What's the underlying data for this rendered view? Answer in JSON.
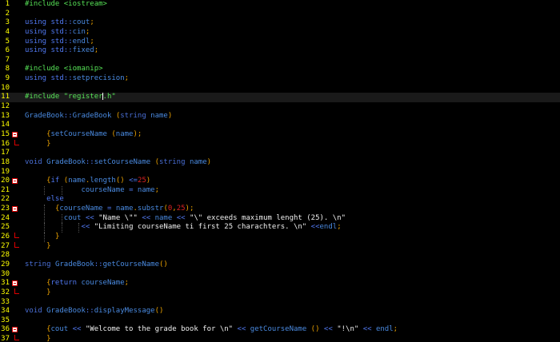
{
  "editor": {
    "colors": {
      "background": "#000000",
      "line_number": "#ffff00",
      "preprocessor": "#56e156",
      "keyword": "#5078f0",
      "punctuation": "#e8a000",
      "string": "#f0f0f0",
      "number": "#dd2222",
      "fold_marker": "#dd0000"
    },
    "lines": [
      {
        "n": "1",
        "tokens": [
          [
            "pre",
            "#include <iostream>"
          ]
        ]
      },
      {
        "n": "2",
        "tokens": []
      },
      {
        "n": "3",
        "tokens": [
          [
            "kw",
            "using "
          ],
          [
            "ns",
            "std"
          ],
          [
            "op",
            "::"
          ],
          [
            "id",
            "cout"
          ],
          [
            "punc",
            ";"
          ]
        ]
      },
      {
        "n": "4",
        "tokens": [
          [
            "kw",
            "using "
          ],
          [
            "ns",
            "std"
          ],
          [
            "op",
            "::"
          ],
          [
            "id",
            "cin"
          ],
          [
            "punc",
            ";"
          ]
        ]
      },
      {
        "n": "5",
        "tokens": [
          [
            "kw",
            "using "
          ],
          [
            "ns",
            "std"
          ],
          [
            "op",
            "::"
          ],
          [
            "id",
            "endl"
          ],
          [
            "punc",
            ";"
          ]
        ]
      },
      {
        "n": "6",
        "tokens": [
          [
            "kw",
            "using "
          ],
          [
            "ns",
            "std"
          ],
          [
            "op",
            "::"
          ],
          [
            "id",
            "fixed"
          ],
          [
            "punc",
            ";"
          ]
        ]
      },
      {
        "n": "7",
        "tokens": []
      },
      {
        "n": "8",
        "tokens": [
          [
            "pre",
            "#include <iomanip>"
          ]
        ]
      },
      {
        "n": "9",
        "tokens": [
          [
            "kw",
            "using "
          ],
          [
            "ns",
            "std"
          ],
          [
            "op",
            "::"
          ],
          [
            "id",
            "setprecision"
          ],
          [
            "punc",
            ";"
          ]
        ]
      },
      {
        "n": "10",
        "tokens": []
      },
      {
        "n": "11",
        "tokens": [
          [
            "pre",
            "#include \"register"
          ],
          [
            "caret",
            ""
          ],
          [
            "pre",
            ".h\""
          ]
        ],
        "current": true
      },
      {
        "n": "12",
        "tokens": []
      },
      {
        "n": "13",
        "tokens": [
          [
            "id",
            "GradeBook"
          ],
          [
            "op",
            "::"
          ],
          [
            "id",
            "GradeBook "
          ],
          [
            "punc",
            "("
          ],
          [
            "type",
            "string "
          ],
          [
            "id",
            "name"
          ],
          [
            "punc",
            ")"
          ]
        ]
      },
      {
        "n": "14",
        "tokens": []
      },
      {
        "n": "15",
        "fold": "open",
        "tokens": [
          [
            "plain",
            "     "
          ],
          [
            "punc",
            "{"
          ],
          [
            "id",
            "setCourseName "
          ],
          [
            "punc",
            "("
          ],
          [
            "id",
            "name"
          ],
          [
            "punc",
            ");"
          ]
        ]
      },
      {
        "n": "16",
        "fold": "end",
        "tokens": [
          [
            "plain",
            "     "
          ],
          [
            "punc",
            "}"
          ]
        ]
      },
      {
        "n": "17",
        "tokens": []
      },
      {
        "n": "18",
        "tokens": [
          [
            "type",
            "void "
          ],
          [
            "id",
            "GradeBook"
          ],
          [
            "op",
            "::"
          ],
          [
            "id",
            "setCourseName "
          ],
          [
            "punc",
            "("
          ],
          [
            "type",
            "string "
          ],
          [
            "id",
            "name"
          ],
          [
            "punc",
            ")"
          ]
        ]
      },
      {
        "n": "19",
        "tokens": []
      },
      {
        "n": "20",
        "fold": "open",
        "tokens": [
          [
            "plain",
            "     "
          ],
          [
            "punc",
            "{"
          ],
          [
            "kw",
            "if "
          ],
          [
            "punc",
            "("
          ],
          [
            "id",
            "name"
          ],
          [
            "punc",
            "."
          ],
          [
            "member",
            "length"
          ],
          [
            "punc",
            "() "
          ],
          [
            "op",
            "<="
          ],
          [
            "num",
            "25"
          ],
          [
            "punc",
            ")"
          ]
        ]
      },
      {
        "n": "21",
        "fold": "mid",
        "guides": [
          1,
          2
        ],
        "tokens": [
          [
            "plain",
            "             "
          ],
          [
            "id",
            "courseName "
          ],
          [
            "op",
            "= "
          ],
          [
            "id",
            "name"
          ],
          [
            "punc",
            ";"
          ]
        ]
      },
      {
        "n": "22",
        "fold": "mid",
        "tokens": [
          [
            "plain",
            "     "
          ],
          [
            "kw",
            "else"
          ]
        ]
      },
      {
        "n": "23",
        "fold": "open",
        "guides": [
          1
        ],
        "tokens": [
          [
            "plain",
            "       "
          ],
          [
            "punc",
            "{"
          ],
          [
            "id",
            "courseName "
          ],
          [
            "op",
            "= "
          ],
          [
            "id",
            "name"
          ],
          [
            "punc",
            "."
          ],
          [
            "member",
            "substr"
          ],
          [
            "punc",
            "("
          ],
          [
            "num",
            "0"
          ],
          [
            "punc",
            ","
          ],
          [
            "num",
            "25"
          ],
          [
            "punc",
            ");"
          ]
        ]
      },
      {
        "n": "24",
        "fold": "mid",
        "guides": [
          1,
          2
        ],
        "tokens": [
          [
            "plain",
            "         "
          ],
          [
            "id",
            "cout "
          ],
          [
            "op",
            "<< "
          ],
          [
            "str",
            "\"Name \\\"\" "
          ],
          [
            "op",
            "<< "
          ],
          [
            "id",
            "name "
          ],
          [
            "op",
            "<< "
          ],
          [
            "str",
            "\"\\\" exceeds maximum lenght (25). \\n\""
          ]
        ]
      },
      {
        "n": "25",
        "fold": "mid",
        "guides": [
          1,
          2,
          3
        ],
        "tokens": [
          [
            "plain",
            "             "
          ],
          [
            "op",
            "<< "
          ],
          [
            "str",
            "\"Limiting courseName ti first 25 charachters. \\n\" "
          ],
          [
            "op",
            "<<"
          ],
          [
            "id",
            "endl"
          ],
          [
            "punc",
            ";"
          ]
        ]
      },
      {
        "n": "26",
        "fold": "end",
        "guides": [
          1
        ],
        "tokens": [
          [
            "plain",
            "       "
          ],
          [
            "punc",
            "}"
          ]
        ]
      },
      {
        "n": "27",
        "fold": "end",
        "tokens": [
          [
            "plain",
            "     "
          ],
          [
            "punc",
            "}"
          ]
        ]
      },
      {
        "n": "28",
        "tokens": []
      },
      {
        "n": "29",
        "tokens": [
          [
            "type",
            "string "
          ],
          [
            "id",
            "GradeBook"
          ],
          [
            "op",
            "::"
          ],
          [
            "id",
            "getCourseName"
          ],
          [
            "punc",
            "()"
          ]
        ]
      },
      {
        "n": "30",
        "tokens": []
      },
      {
        "n": "31",
        "fold": "open",
        "tokens": [
          [
            "plain",
            "     "
          ],
          [
            "punc",
            "{"
          ],
          [
            "kw",
            "return "
          ],
          [
            "id",
            "courseName"
          ],
          [
            "punc",
            ";"
          ]
        ]
      },
      {
        "n": "32",
        "fold": "end",
        "tokens": [
          [
            "plain",
            "     "
          ],
          [
            "punc",
            "}"
          ]
        ]
      },
      {
        "n": "33",
        "tokens": []
      },
      {
        "n": "34",
        "tokens": [
          [
            "type",
            "void "
          ],
          [
            "id",
            "GradeBook"
          ],
          [
            "op",
            "::"
          ],
          [
            "id",
            "displayMessage"
          ],
          [
            "punc",
            "()"
          ]
        ]
      },
      {
        "n": "35",
        "tokens": []
      },
      {
        "n": "36",
        "fold": "open",
        "tokens": [
          [
            "plain",
            "     "
          ],
          [
            "punc",
            "{"
          ],
          [
            "id",
            "cout "
          ],
          [
            "op",
            "<< "
          ],
          [
            "str",
            "\"Welcome to the grade book for \\n\" "
          ],
          [
            "op",
            "<< "
          ],
          [
            "id",
            "getCourseName "
          ],
          [
            "punc",
            "() "
          ],
          [
            "op",
            "<< "
          ],
          [
            "str",
            "\"!\\n\" "
          ],
          [
            "op",
            "<< "
          ],
          [
            "id",
            "endl"
          ],
          [
            "punc",
            ";"
          ]
        ]
      },
      {
        "n": "37",
        "fold": "end",
        "tokens": [
          [
            "plain",
            "     "
          ],
          [
            "punc",
            "}"
          ]
        ]
      }
    ]
  }
}
